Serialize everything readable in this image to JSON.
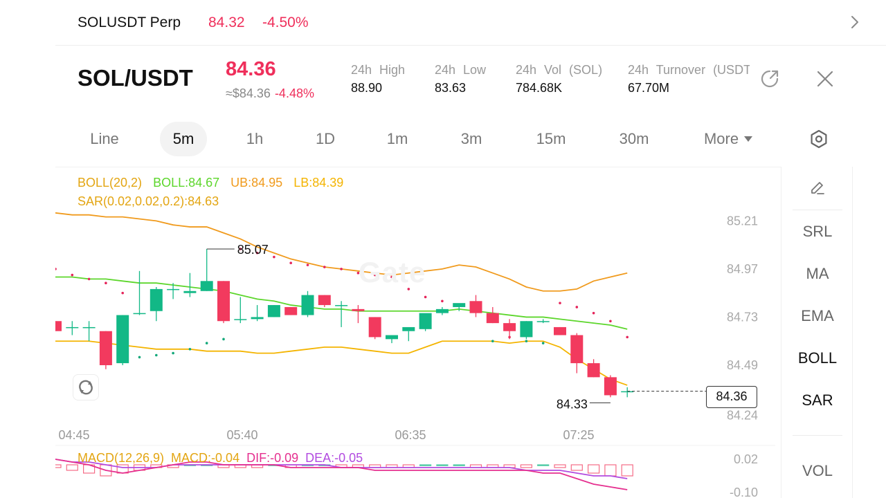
{
  "topbar": {
    "symbol": "SOLUSDT Perp",
    "price": "84.32",
    "change": "-4.50%"
  },
  "header": {
    "pair": "SOL/USDT",
    "price": "84.36",
    "approx": "≈$84.36",
    "approx_change": "-4.48%",
    "stats": [
      {
        "label": "24h High",
        "value": "88.90"
      },
      {
        "label": "24h Low",
        "value": "83.63"
      },
      {
        "label": "24h Vol (SOL)",
        "value": "784.68K"
      },
      {
        "label": "24h Turnover (USDT)",
        "value": "67.70M"
      }
    ]
  },
  "tabs": [
    "Line",
    "5m",
    "1h",
    "1D",
    "1m",
    "3m",
    "15m",
    "30m",
    "More"
  ],
  "active_tab": "5m",
  "indicators": {
    "boll_name": "BOLL(20,2)",
    "boll_mid": "BOLL:84.67",
    "boll_ub": "UB:84.95",
    "boll_lb": "LB:84.39",
    "sar": "SAR(0.02,0.02,0.2):84.63"
  },
  "watermark": "Gate",
  "chart_labels": {
    "high_marker": "85.07",
    "low_marker": "84.33",
    "last_price": "84.36",
    "y_ticks": [
      "85.21",
      "84.97",
      "84.73",
      "84.49",
      "84.24"
    ],
    "x_ticks": [
      "04:45",
      "05:40",
      "06:35",
      "07:25"
    ]
  },
  "macd": {
    "name": "MACD(12,26,9)",
    "macd": "MACD:-0.04",
    "dif": "DIF:-0.09",
    "dea": "DEA:-0.05",
    "y_ticks": [
      "0.02",
      "-0.10"
    ]
  },
  "side_panel": [
    "SRL",
    "MA",
    "EMA",
    "BOLL",
    "SAR",
    "VOL"
  ],
  "colors": {
    "up": "#12b886",
    "down": "#f23a5e",
    "boll_mid": "#5cd62b",
    "boll_upper": "#f09a1c",
    "boll_lower": "#f4b400",
    "sar_up": "#12a87a",
    "sar_down": "#e5245a",
    "dif": "#e52f8f",
    "dea": "#b24be0"
  },
  "chart_data": {
    "type": "candlestick",
    "interval": "5m",
    "ylim": [
      84.2,
      85.27
    ],
    "candles": [
      {
        "o": 84.71,
        "h": 84.71,
        "l": 84.66,
        "c": 84.66
      },
      {
        "o": 84.68,
        "h": 84.71,
        "l": 84.64,
        "c": 84.68
      },
      {
        "o": 84.68,
        "h": 84.71,
        "l": 84.61,
        "c": 84.68
      },
      {
        "o": 84.66,
        "h": 84.66,
        "l": 84.47,
        "c": 84.49
      },
      {
        "o": 84.5,
        "h": 84.74,
        "l": 84.49,
        "c": 84.74
      },
      {
        "o": 84.75,
        "h": 84.96,
        "l": 84.74,
        "c": 84.75
      },
      {
        "o": 84.76,
        "h": 84.88,
        "l": 84.71,
        "c": 84.87
      },
      {
        "o": 84.87,
        "h": 84.9,
        "l": 84.82,
        "c": 84.87
      },
      {
        "o": 84.85,
        "h": 84.95,
        "l": 84.83,
        "c": 84.86
      },
      {
        "o": 84.86,
        "h": 85.07,
        "l": 84.86,
        "c": 84.91
      },
      {
        "o": 84.91,
        "h": 84.91,
        "l": 84.7,
        "c": 84.71
      },
      {
        "o": 84.72,
        "h": 84.83,
        "l": 84.7,
        "c": 84.72
      },
      {
        "o": 84.72,
        "h": 84.79,
        "l": 84.71,
        "c": 84.73
      },
      {
        "o": 84.73,
        "h": 84.79,
        "l": 84.73,
        "c": 84.79
      },
      {
        "o": 84.78,
        "h": 84.78,
        "l": 84.74,
        "c": 84.74
      },
      {
        "o": 84.74,
        "h": 84.86,
        "l": 84.73,
        "c": 84.84
      },
      {
        "o": 84.84,
        "h": 84.84,
        "l": 84.78,
        "c": 84.79
      },
      {
        "o": 84.79,
        "h": 84.81,
        "l": 84.68,
        "c": 84.79
      },
      {
        "o": 84.77,
        "h": 84.79,
        "l": 84.7,
        "c": 84.76
      },
      {
        "o": 84.73,
        "h": 84.73,
        "l": 84.62,
        "c": 84.63
      },
      {
        "o": 84.62,
        "h": 84.64,
        "l": 84.6,
        "c": 84.64
      },
      {
        "o": 84.66,
        "h": 84.66,
        "l": 84.61,
        "c": 84.68
      },
      {
        "o": 84.67,
        "h": 84.74,
        "l": 84.66,
        "c": 84.75
      },
      {
        "o": 84.75,
        "h": 84.78,
        "l": 84.74,
        "c": 84.77
      },
      {
        "o": 84.78,
        "h": 84.79,
        "l": 84.76,
        "c": 84.8
      },
      {
        "o": 84.81,
        "h": 84.84,
        "l": 84.73,
        "c": 84.75
      },
      {
        "o": 84.75,
        "h": 84.78,
        "l": 84.7,
        "c": 84.7
      },
      {
        "o": 84.7,
        "h": 84.72,
        "l": 84.62,
        "c": 84.66
      },
      {
        "o": 84.63,
        "h": 84.71,
        "l": 84.62,
        "c": 84.71
      },
      {
        "o": 84.71,
        "h": 84.72,
        "l": 84.7,
        "c": 84.71
      },
      {
        "o": 84.68,
        "h": 84.68,
        "l": 84.64,
        "c": 84.64
      },
      {
        "o": 84.64,
        "h": 84.65,
        "l": 84.45,
        "c": 84.5
      },
      {
        "o": 84.5,
        "h": 84.52,
        "l": 84.43,
        "c": 84.43
      },
      {
        "o": 84.43,
        "h": 84.44,
        "l": 84.33,
        "c": 84.34
      },
      {
        "o": 84.36,
        "h": 84.38,
        "l": 84.33,
        "c": 84.36
      }
    ],
    "boll_upper": [
      85.25,
      85.24,
      85.24,
      85.23,
      85.23,
      85.22,
      85.21,
      85.19,
      85.18,
      85.18,
      85.15,
      85.12,
      85.08,
      85.05,
      85.02,
      85.0,
      84.98,
      84.97,
      84.96,
      84.95,
      84.94,
      84.95,
      84.96,
      84.97,
      84.99,
      84.98,
      84.95,
      84.92,
      84.88,
      84.86,
      84.86,
      84.87,
      84.91,
      84.93,
      84.95
    ],
    "boll_mid": [
      84.93,
      84.93,
      84.92,
      84.92,
      84.91,
      84.9,
      84.9,
      84.89,
      84.88,
      84.87,
      84.86,
      84.84,
      84.82,
      84.81,
      84.79,
      84.78,
      84.77,
      84.77,
      84.76,
      84.76,
      84.76,
      84.76,
      84.76,
      84.76,
      84.77,
      84.76,
      84.75,
      84.74,
      84.73,
      84.73,
      84.72,
      84.71,
      84.7,
      84.69,
      84.67
    ],
    "boll_lower": [
      84.61,
      84.61,
      84.61,
      84.6,
      84.59,
      84.58,
      84.57,
      84.57,
      84.57,
      84.56,
      84.56,
      84.56,
      84.55,
      84.55,
      84.56,
      84.57,
      84.58,
      84.58,
      84.57,
      84.56,
      84.55,
      84.55,
      84.58,
      84.61,
      84.61,
      84.61,
      84.61,
      84.6,
      84.61,
      84.61,
      84.58,
      84.52,
      84.47,
      84.42,
      84.39
    ],
    "sar": [
      84.97,
      84.94,
      84.92,
      84.9,
      84.85,
      84.53,
      84.54,
      84.55,
      84.57,
      84.6,
      84.62,
      85.07,
      85.05,
      85.03,
      85.0,
      84.99,
      84.98,
      84.97,
      84.95,
      84.94,
      84.93,
      84.87,
      84.83,
      84.81,
      84.79,
      84.76,
      84.61,
      84.63,
      84.61,
      84.6,
      84.8,
      84.78,
      84.75,
      84.71,
      84.63
    ],
    "macd": {
      "hist": [
        -0.01,
        -0.02,
        -0.03,
        -0.04,
        -0.03,
        -0.02,
        -0.01,
        -0.01,
        0.0,
        0.0,
        -0.01,
        -0.01,
        -0.01,
        0.0,
        -0.01,
        0.0,
        0.0,
        -0.01,
        -0.01,
        -0.01,
        -0.01,
        -0.01,
        0.0,
        0.0,
        0.0,
        -0.01,
        -0.01,
        -0.01,
        -0.01,
        0.0,
        -0.01,
        -0.02,
        -0.03,
        -0.04,
        -0.04
      ],
      "dif": [
        0.02,
        0.01,
        0.0,
        -0.02,
        -0.03,
        -0.02,
        -0.01,
        0.0,
        0.01,
        0.01,
        0.0,
        0.0,
        0.0,
        0.0,
        -0.01,
        -0.01,
        -0.01,
        -0.01,
        -0.01,
        -0.02,
        -0.02,
        -0.02,
        -0.02,
        -0.02,
        -0.02,
        -0.02,
        -0.02,
        -0.02,
        -0.02,
        -0.03,
        -0.03,
        -0.05,
        -0.07,
        -0.08,
        -0.09
      ],
      "dea": [
        0.02,
        0.01,
        0.01,
        0.0,
        -0.01,
        -0.01,
        -0.01,
        0.0,
        0.0,
        0.0,
        0.0,
        0.0,
        0.0,
        0.0,
        0.0,
        0.0,
        0.0,
        -0.01,
        -0.01,
        -0.01,
        -0.01,
        -0.01,
        -0.01,
        -0.01,
        -0.01,
        -0.01,
        -0.01,
        -0.01,
        -0.02,
        -0.02,
        -0.02,
        -0.03,
        -0.04,
        -0.04,
        -0.05
      ],
      "ylim": [
        -0.1,
        0.03
      ]
    }
  }
}
